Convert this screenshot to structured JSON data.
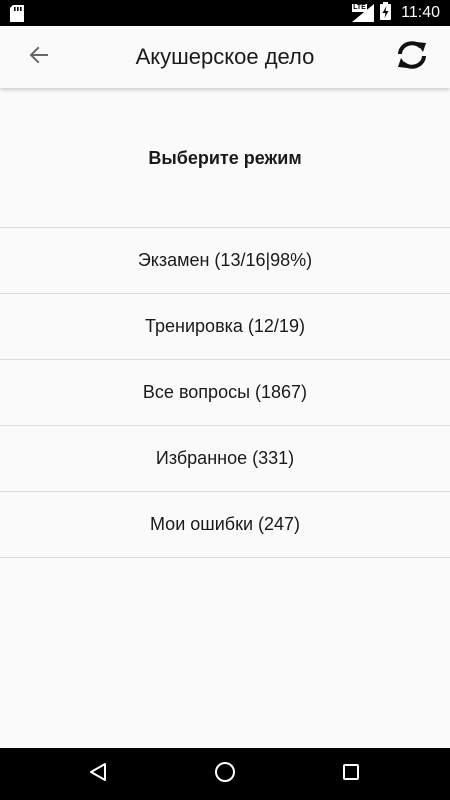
{
  "status_bar": {
    "network": "LTE",
    "time": "11:40",
    "icons": [
      "sd-card-icon",
      "signal-icon",
      "battery-charging-icon"
    ]
  },
  "app_bar": {
    "title": "Акушерское дело",
    "back_icon": "arrow-left-icon",
    "sync_icon": "sync-icon"
  },
  "main": {
    "section_title": "Выберите режим",
    "modes": [
      {
        "label": "Экзамен (13/16|98%)"
      },
      {
        "label": "Тренировка (12/19)"
      },
      {
        "label": "Все вопросы (1867)"
      },
      {
        "label": "Избранное (331)"
      },
      {
        "label": "Мои ошибки (247)"
      }
    ]
  },
  "nav_bar": {
    "icons": [
      "nav-back-icon",
      "nav-home-icon",
      "nav-recents-icon"
    ]
  },
  "colors": {
    "background": "#fafafa",
    "bars": "#000000",
    "divider": "#dcdcdc",
    "text": "#1a1a1a"
  }
}
